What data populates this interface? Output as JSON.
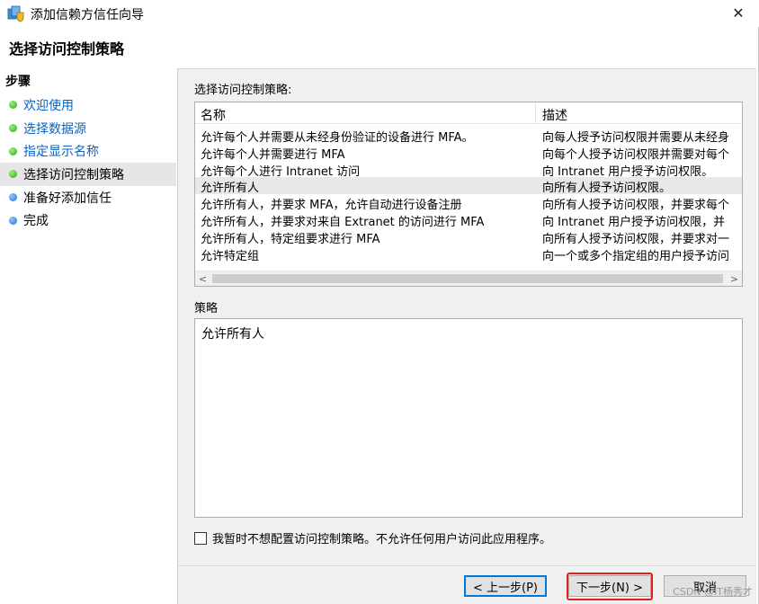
{
  "window": {
    "title": "添加信赖方信任向导",
    "close_glyph": "✕"
  },
  "page": {
    "title": "选择访问控制策略"
  },
  "steps": {
    "title": "步骤",
    "items": [
      {
        "label": "欢迎使用",
        "state": "done"
      },
      {
        "label": "选择数据源",
        "state": "done"
      },
      {
        "label": "指定显示名称",
        "state": "done"
      },
      {
        "label": "选择访问控制策略",
        "state": "current"
      },
      {
        "label": "准备好添加信任",
        "state": "pending"
      },
      {
        "label": "完成",
        "state": "pending"
      }
    ]
  },
  "policy_list": {
    "label": "选择访问控制策略:",
    "columns": {
      "name": "名称",
      "description": "描述"
    },
    "rows": [
      {
        "name": "允许每个人并需要从未经身份验证的设备进行 MFA。",
        "description": "向每人授予访问权限并需要从未经身"
      },
      {
        "name": "允许每个人并需要进行 MFA",
        "description": "向每个人授予访问权限并需要对每个"
      },
      {
        "name": "允许每个人进行 Intranet 访问",
        "description": "向 Intranet 用户授予访问权限。"
      },
      {
        "name": "允许所有人",
        "description": "向所有人授予访问权限。"
      },
      {
        "name": "允许所有人，并要求 MFA，允许自动进行设备注册",
        "description": "向所有人授予访问权限，并要求每个"
      },
      {
        "name": "允许所有人，并要求对来自 Extranet 的访问进行 MFA",
        "description": "向 Intranet 用户授予访问权限，并"
      },
      {
        "name": "允许所有人，特定组要求进行 MFA",
        "description": "向所有人授予访问权限，并要求对一"
      },
      {
        "name": "允许特定组",
        "description": "向一个或多个指定组的用户授予访问"
      }
    ],
    "selected_index": 3,
    "scroll_left": "<",
    "scroll_right": ">"
  },
  "policy_detail": {
    "label": "策略",
    "text": "允许所有人"
  },
  "opt_out": {
    "checked": false,
    "label": "我暂时不想配置访问控制策略。不允许任何用户访问此应用程序。"
  },
  "buttons": {
    "back": "< 上一步(P)",
    "next": "下一步(N) >",
    "cancel": "取消"
  },
  "watermark": "CSDN @IT杨秀才",
  "colors": {
    "link": "#0a62c7",
    "step_done": "#2fa51a",
    "step_pending": "#1b6fd6",
    "highlight": "#e02020"
  }
}
